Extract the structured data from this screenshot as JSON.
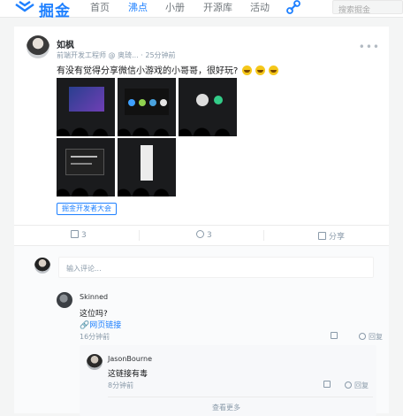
{
  "nav": {
    "logo_text": "掘金",
    "items": [
      "首页",
      "沸点",
      "小册",
      "开源库",
      "活动"
    ],
    "active_index": 1,
    "search_placeholder": "搜索掘金",
    "accent": "#1e80ff"
  },
  "post": {
    "author": "如枫",
    "meta": "前端开发工程师 @ 奥琦...",
    "time": "· 25分钟前",
    "text": "有没有觉得分享微信小游戏的小哥哥，很好玩?",
    "emoji_count": 3,
    "tag": "掘金开发者大会",
    "actions": {
      "like_count": "3",
      "comment_count": "3",
      "share_label": "分享"
    }
  },
  "comments": {
    "input_placeholder": "输入评论...",
    "items": [
      {
        "author": "Skinned",
        "text": "这位吗?",
        "link": "网页链接",
        "time": "16分钟前",
        "reply_label": "回复",
        "replies": [
          {
            "author": "JasonBourne",
            "text": "这链接有毒",
            "time": "8分钟前",
            "reply_label": "回复"
          }
        ]
      }
    ],
    "view_more": "查看更多"
  }
}
